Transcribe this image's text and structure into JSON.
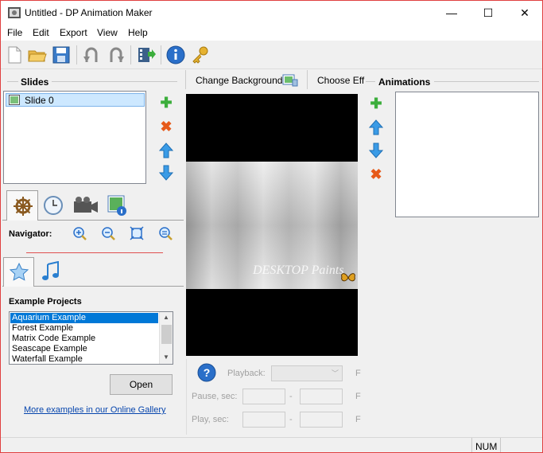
{
  "window": {
    "title": "Untitled - DP Animation Maker",
    "minimize": "—",
    "maximize": "☐",
    "close": "✕"
  },
  "menu": [
    "File",
    "Edit",
    "Export",
    "View",
    "Help"
  ],
  "toolbar": {
    "icons": [
      "new-icon",
      "open-folder-icon",
      "save-icon",
      "undo-icon",
      "redo-icon",
      "export-video-icon",
      "info-icon",
      "key-icon"
    ]
  },
  "slides": {
    "header": "Slides",
    "items": [
      "Slide 0"
    ]
  },
  "stage": {
    "change_background": "Change Background",
    "choose_effect": "Choose Eff",
    "watermark": "DESKTOP Paints"
  },
  "animations": {
    "header": "Animations"
  },
  "navigator": {
    "label": "Navigator:"
  },
  "examples": {
    "header": "Example Projects",
    "items": [
      "Aquarium Example",
      "Forest Example",
      "Matrix Code Example",
      "Seascape Example",
      "Waterfall Example"
    ],
    "selected_index": 0,
    "open_button": "Open",
    "gallery_link": "More examples in our Online Gallery"
  },
  "playback": {
    "playback_label": "Playback:",
    "pause_label": "Pause, sec:",
    "play_label": "Play, sec:",
    "dash": "-",
    "trailing_f": "F"
  },
  "statusbar": {
    "num": "NUM"
  }
}
